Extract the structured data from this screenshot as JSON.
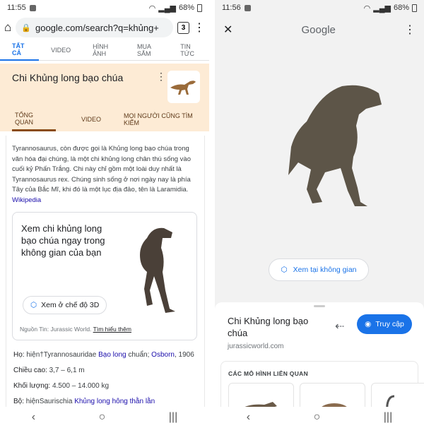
{
  "left": {
    "status": {
      "time": "11:55",
      "battery": "68%"
    },
    "url": "google.com/search?q=khủng+",
    "tab_count": "3",
    "search_tabs": [
      "TẤT CẢ",
      "VIDEO",
      "HÌNH ẢNH",
      "MUA SẮM",
      "TIN TỨC"
    ],
    "kp": {
      "title": "Chi Khủng long bạo chúa",
      "tabs": [
        "TỔNG QUAN",
        "VIDEO",
        "MỌI NGƯỜI CŨNG TÌM KIẾM"
      ]
    },
    "description": "Tyrannosaurus, còn được gọi là Khủng long bạo chúa trong văn hóa đại chúng, là một chi khủng long chân thú sống vào cuối kỷ Phấn Trắng. Chi này chỉ gồm một loài duy nhất là Tyrannosaurus rex. Chúng sinh sống ở nơi ngày nay là phía Tây của Bắc Mĩ, khi đó là một lục địa đảo, tên là Laramidia.",
    "wikipedia_link": "Wikipedia",
    "ar": {
      "text": "Xem chi khủng long bạo chúa ngay trong không gian của bạn",
      "button": "Xem ở chế độ 3D",
      "source_prefix": "Nguồn Tin: Jurassic World.",
      "learn_more": "Tìm hiểu thêm"
    },
    "facts": [
      {
        "key": "Họ:",
        "plain": "hiện†Tyrannosauridae",
        "link": "Bạo long",
        "after": "chuẩn;",
        "link2": "Osborn",
        "tail": ", 1906"
      },
      {
        "key": "Chiều cao:",
        "plain": "3,7 – 6,1 m"
      },
      {
        "key": "Khối lượng:",
        "plain": "4.500 – 14.000 kg"
      },
      {
        "key": "Bộ:",
        "plain": "hiệnSaurischia",
        "link": "Khủng long hông thằn lằn"
      }
    ]
  },
  "right": {
    "status": {
      "time": "11:56",
      "battery": "68%"
    },
    "title": "Google",
    "view_in_space": "Xem tại không gian",
    "sheet": {
      "title": "Chi Khủng long bạo chúa",
      "domain": "jurassicworld.com",
      "visit": "Truy cập",
      "related_label": "CÁC MÔ HÌNH LIÊN QUAN"
    }
  }
}
